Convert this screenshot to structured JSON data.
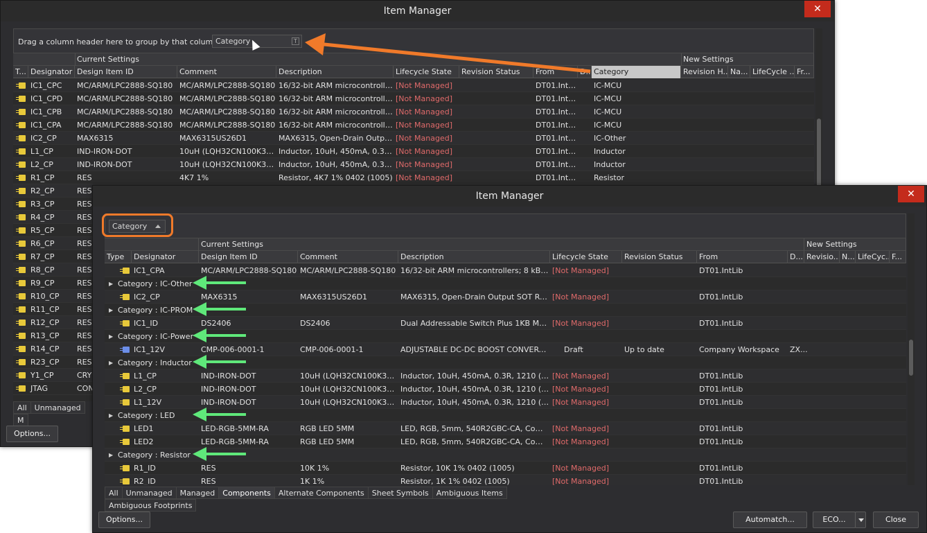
{
  "back": {
    "title": "Item Manager",
    "close_glyph": "✕",
    "group_hint": "Drag a column header here to group by that column",
    "drag_chip": "Category",
    "filter_glyph": "T",
    "band_current": "Current Settings",
    "band_new": "New Settings",
    "columns": [
      "T...",
      "Designator",
      "Design Item ID",
      "Comment",
      "Description",
      "Lifecycle State",
      "Revision Status",
      "From",
      "D...",
      "Category",
      "Revision H...",
      "Na...",
      "LifeCycle ...",
      "Fr..."
    ],
    "rows": [
      {
        "des": "IC1_CPC",
        "id": "MC/ARM/LPC2888-SQ180",
        "comment": "MC/ARM/LPC2888-SQ180",
        "desc": "16/32-bit ARM microcontroller...",
        "life": "[Not Managed]",
        "from": "DT01.IntLib",
        "cat": "IC-MCU"
      },
      {
        "des": "IC1_CPD",
        "id": "MC/ARM/LPC2888-SQ180",
        "comment": "MC/ARM/LPC2888-SQ180",
        "desc": "16/32-bit ARM microcontroller...",
        "life": "[Not Managed]",
        "from": "DT01.IntLib",
        "cat": "IC-MCU"
      },
      {
        "des": "IC1_CPB",
        "id": "MC/ARM/LPC2888-SQ180",
        "comment": "MC/ARM/LPC2888-SQ180",
        "desc": "16/32-bit ARM microcontroller...",
        "life": "[Not Managed]",
        "from": "DT01.IntLib",
        "cat": "IC-MCU"
      },
      {
        "des": "IC1_CPA",
        "id": "MC/ARM/LPC2888-SQ180",
        "comment": "MC/ARM/LPC2888-SQ180",
        "desc": "16/32-bit ARM microcontroller...",
        "life": "[Not Managed]",
        "from": "DT01.IntLib",
        "cat": "IC-MCU"
      },
      {
        "des": "IC2_CP",
        "id": "MAX6315",
        "comment": "MAX6315US26D1",
        "desc": "MAX6315, Open-Drain Output...",
        "life": "[Not Managed]",
        "from": "DT01.IntLib",
        "cat": "IC-Other"
      },
      {
        "des": "L1_CP",
        "id": "IND-IRON-DOT",
        "comment": "10uH (LQH32CN100K33L)",
        "desc": "Inductor, 10uH, 450mA, 0.3R, ...",
        "life": "[Not Managed]",
        "from": "DT01.IntLib",
        "cat": "Inductor"
      },
      {
        "des": "L2_CP",
        "id": "IND-IRON-DOT",
        "comment": "10uH (LQH32CN100K33L)",
        "desc": "Inductor, 10uH, 450mA, 0.3R, ...",
        "life": "[Not Managed]",
        "from": "DT01.IntLib",
        "cat": "Inductor"
      },
      {
        "des": "R1_CP",
        "id": "RES",
        "comment": "4K7 1%",
        "desc": "Resistor, 4K7 1% 0402 (1005)",
        "life": "[Not Managed]",
        "from": "DT01.IntLib",
        "cat": "Resistor"
      },
      {
        "des": "R2_CP",
        "id": "RES"
      },
      {
        "des": "R3_CP",
        "id": "RES"
      },
      {
        "des": "R4_CP",
        "id": "RES"
      },
      {
        "des": "R5_CP",
        "id": "RES"
      },
      {
        "des": "R6_CP",
        "id": "RES"
      },
      {
        "des": "R7_CP",
        "id": "RES"
      },
      {
        "des": "R8_CP",
        "id": "RES"
      },
      {
        "des": "R9_CP",
        "id": "RES"
      },
      {
        "des": "R10_CP",
        "id": "RES"
      },
      {
        "des": "R11_CP",
        "id": "RES"
      },
      {
        "des": "R12_CP",
        "id": "RES"
      },
      {
        "des": "R13_CP",
        "id": "RES"
      },
      {
        "des": "R14_CP",
        "id": "RES"
      },
      {
        "des": "R23_CP",
        "id": "RES"
      },
      {
        "des": "Y1_CP",
        "id": "CRYS"
      },
      {
        "des": "JTAG",
        "id": "CON"
      }
    ],
    "tabs": [
      "All",
      "Unmanaged",
      "M"
    ],
    "options_button": "Options..."
  },
  "front": {
    "title": "Item Manager",
    "close_glyph": "✕",
    "group_chip": "Category",
    "band_current": "Current Settings",
    "band_new": "New Settings",
    "columns": [
      "Type",
      "Designator",
      "Design Item ID",
      "Comment",
      "Description",
      "Lifecycle State",
      "Revision Status",
      "From",
      "D...",
      "Revisio...",
      "N...",
      "LifeCyc...",
      "F..."
    ],
    "rows": [
      {
        "kind": "item",
        "icon": "yellow",
        "des": "IC1_CPA",
        "id": "MC/ARM/LPC2888-SQ180",
        "comment": "MC/ARM/LPC2888-SQ180",
        "desc": "16/32-bit ARM microcontrollers; 8 kB cac...",
        "life": "[Not Managed]",
        "rev": "",
        "from": "DT01.IntLib",
        "d": ""
      },
      {
        "kind": "group",
        "label": "Category : IC-Other"
      },
      {
        "kind": "item",
        "icon": "yellow",
        "des": "IC2_CP",
        "id": "MAX6315",
        "comment": "MAX6315US26D1",
        "desc": "MAX6315, Open-Drain Output SOT Rese...",
        "life": "[Not Managed]",
        "rev": "",
        "from": "DT01.IntLib",
        "d": ""
      },
      {
        "kind": "group",
        "label": "Category : IC-PROM"
      },
      {
        "kind": "item",
        "icon": "yellow",
        "des": "IC1_ID",
        "id": "DS2406",
        "comment": "DS2406",
        "desc": "Dual Addressable Switch Plus 1KB Mem...",
        "life": "[Not Managed]",
        "rev": "",
        "from": "DT01.IntLib",
        "d": ""
      },
      {
        "kind": "group",
        "label": "Category : IC-Power"
      },
      {
        "kind": "item",
        "icon": "blue",
        "des": "IC1_12V",
        "id": "CMP-006-0001-1",
        "comment": "CMP-006-0001-1",
        "desc": "ADJUSTABLE DC-DC BOOST CONVERTER...",
        "life": "Draft",
        "rev": "Up to date",
        "from": "Company Workspace",
        "d": "ZX..."
      },
      {
        "kind": "group",
        "label": "Category : Inductor"
      },
      {
        "kind": "item",
        "icon": "yellow",
        "des": "L1_CP",
        "id": "IND-IRON-DOT",
        "comment": "10uH (LQH32CN100K33L)",
        "desc": "Inductor, 10uH, 450mA, 0.3R, 1210 (3225...",
        "life": "[Not Managed]",
        "rev": "",
        "from": "DT01.IntLib",
        "d": ""
      },
      {
        "kind": "item",
        "icon": "yellow",
        "des": "L2_CP",
        "id": "IND-IRON-DOT",
        "comment": "10uH (LQH32CN100K33L)",
        "desc": "Inductor, 10uH, 450mA, 0.3R, 1210 (3225...",
        "life": "[Not Managed]",
        "rev": "",
        "from": "DT01.IntLib",
        "d": ""
      },
      {
        "kind": "item",
        "icon": "yellow",
        "des": "L1_12V",
        "id": "IND-IRON-DOT",
        "comment": "10uH (LQH32CN100K33L)",
        "desc": "Inductor, 10uH, 450mA, 0.3R, 1210 (3225...",
        "life": "[Not Managed]",
        "rev": "",
        "from": "DT01.IntLib",
        "d": ""
      },
      {
        "kind": "group",
        "label": "Category : LED"
      },
      {
        "kind": "item",
        "icon": "yellow",
        "des": "LED1",
        "id": "LED-RGB-5MM-RA",
        "comment": "RGB LED 5MM",
        "desc": "LED, RGB, 5mm, 540R2GBC-CA, Common...",
        "life": "[Not Managed]",
        "rev": "",
        "from": "DT01.IntLib",
        "d": ""
      },
      {
        "kind": "item",
        "icon": "yellow",
        "des": "LED2",
        "id": "LED-RGB-5MM-RA",
        "comment": "RGB LED 5MM",
        "desc": "LED, RGB, 5mm, 540R2GBC-CA, Common...",
        "life": "[Not Managed]",
        "rev": "",
        "from": "DT01.IntLib",
        "d": ""
      },
      {
        "kind": "group",
        "label": "Category : Resistor"
      },
      {
        "kind": "item",
        "icon": "yellow",
        "des": "R1_ID",
        "id": "RES",
        "comment": "10K 1%",
        "desc": "Resistor, 10K 1% 0402 (1005)",
        "life": "[Not Managed]",
        "rev": "",
        "from": "DT01.IntLib",
        "d": ""
      },
      {
        "kind": "item",
        "icon": "yellow",
        "des": "R2_ID",
        "id": "RES",
        "comment": "1K 1%",
        "desc": "Resistor, 1K 1% 0402 (1005)",
        "life": "[Not Managed]",
        "rev": "",
        "from": "DT01.IntLib",
        "d": ""
      }
    ],
    "tabs": [
      "All",
      "Unmanaged",
      "Managed",
      "Components",
      "Alternate Components",
      "Sheet Symbols",
      "Ambiguous Items",
      "Ambiguous Footprints"
    ],
    "active_tab": "Components",
    "options_button": "Options...",
    "automatch_button": "Automatch...",
    "eco_button": "ECO...",
    "close_button": "Close"
  },
  "colors": {
    "window_bg": "#2d2d30",
    "not_managed": "#e06a6a",
    "annotation_orange": "#f07a2a",
    "annotation_green": "#5fe87a",
    "close_red": "#c42b1c"
  }
}
